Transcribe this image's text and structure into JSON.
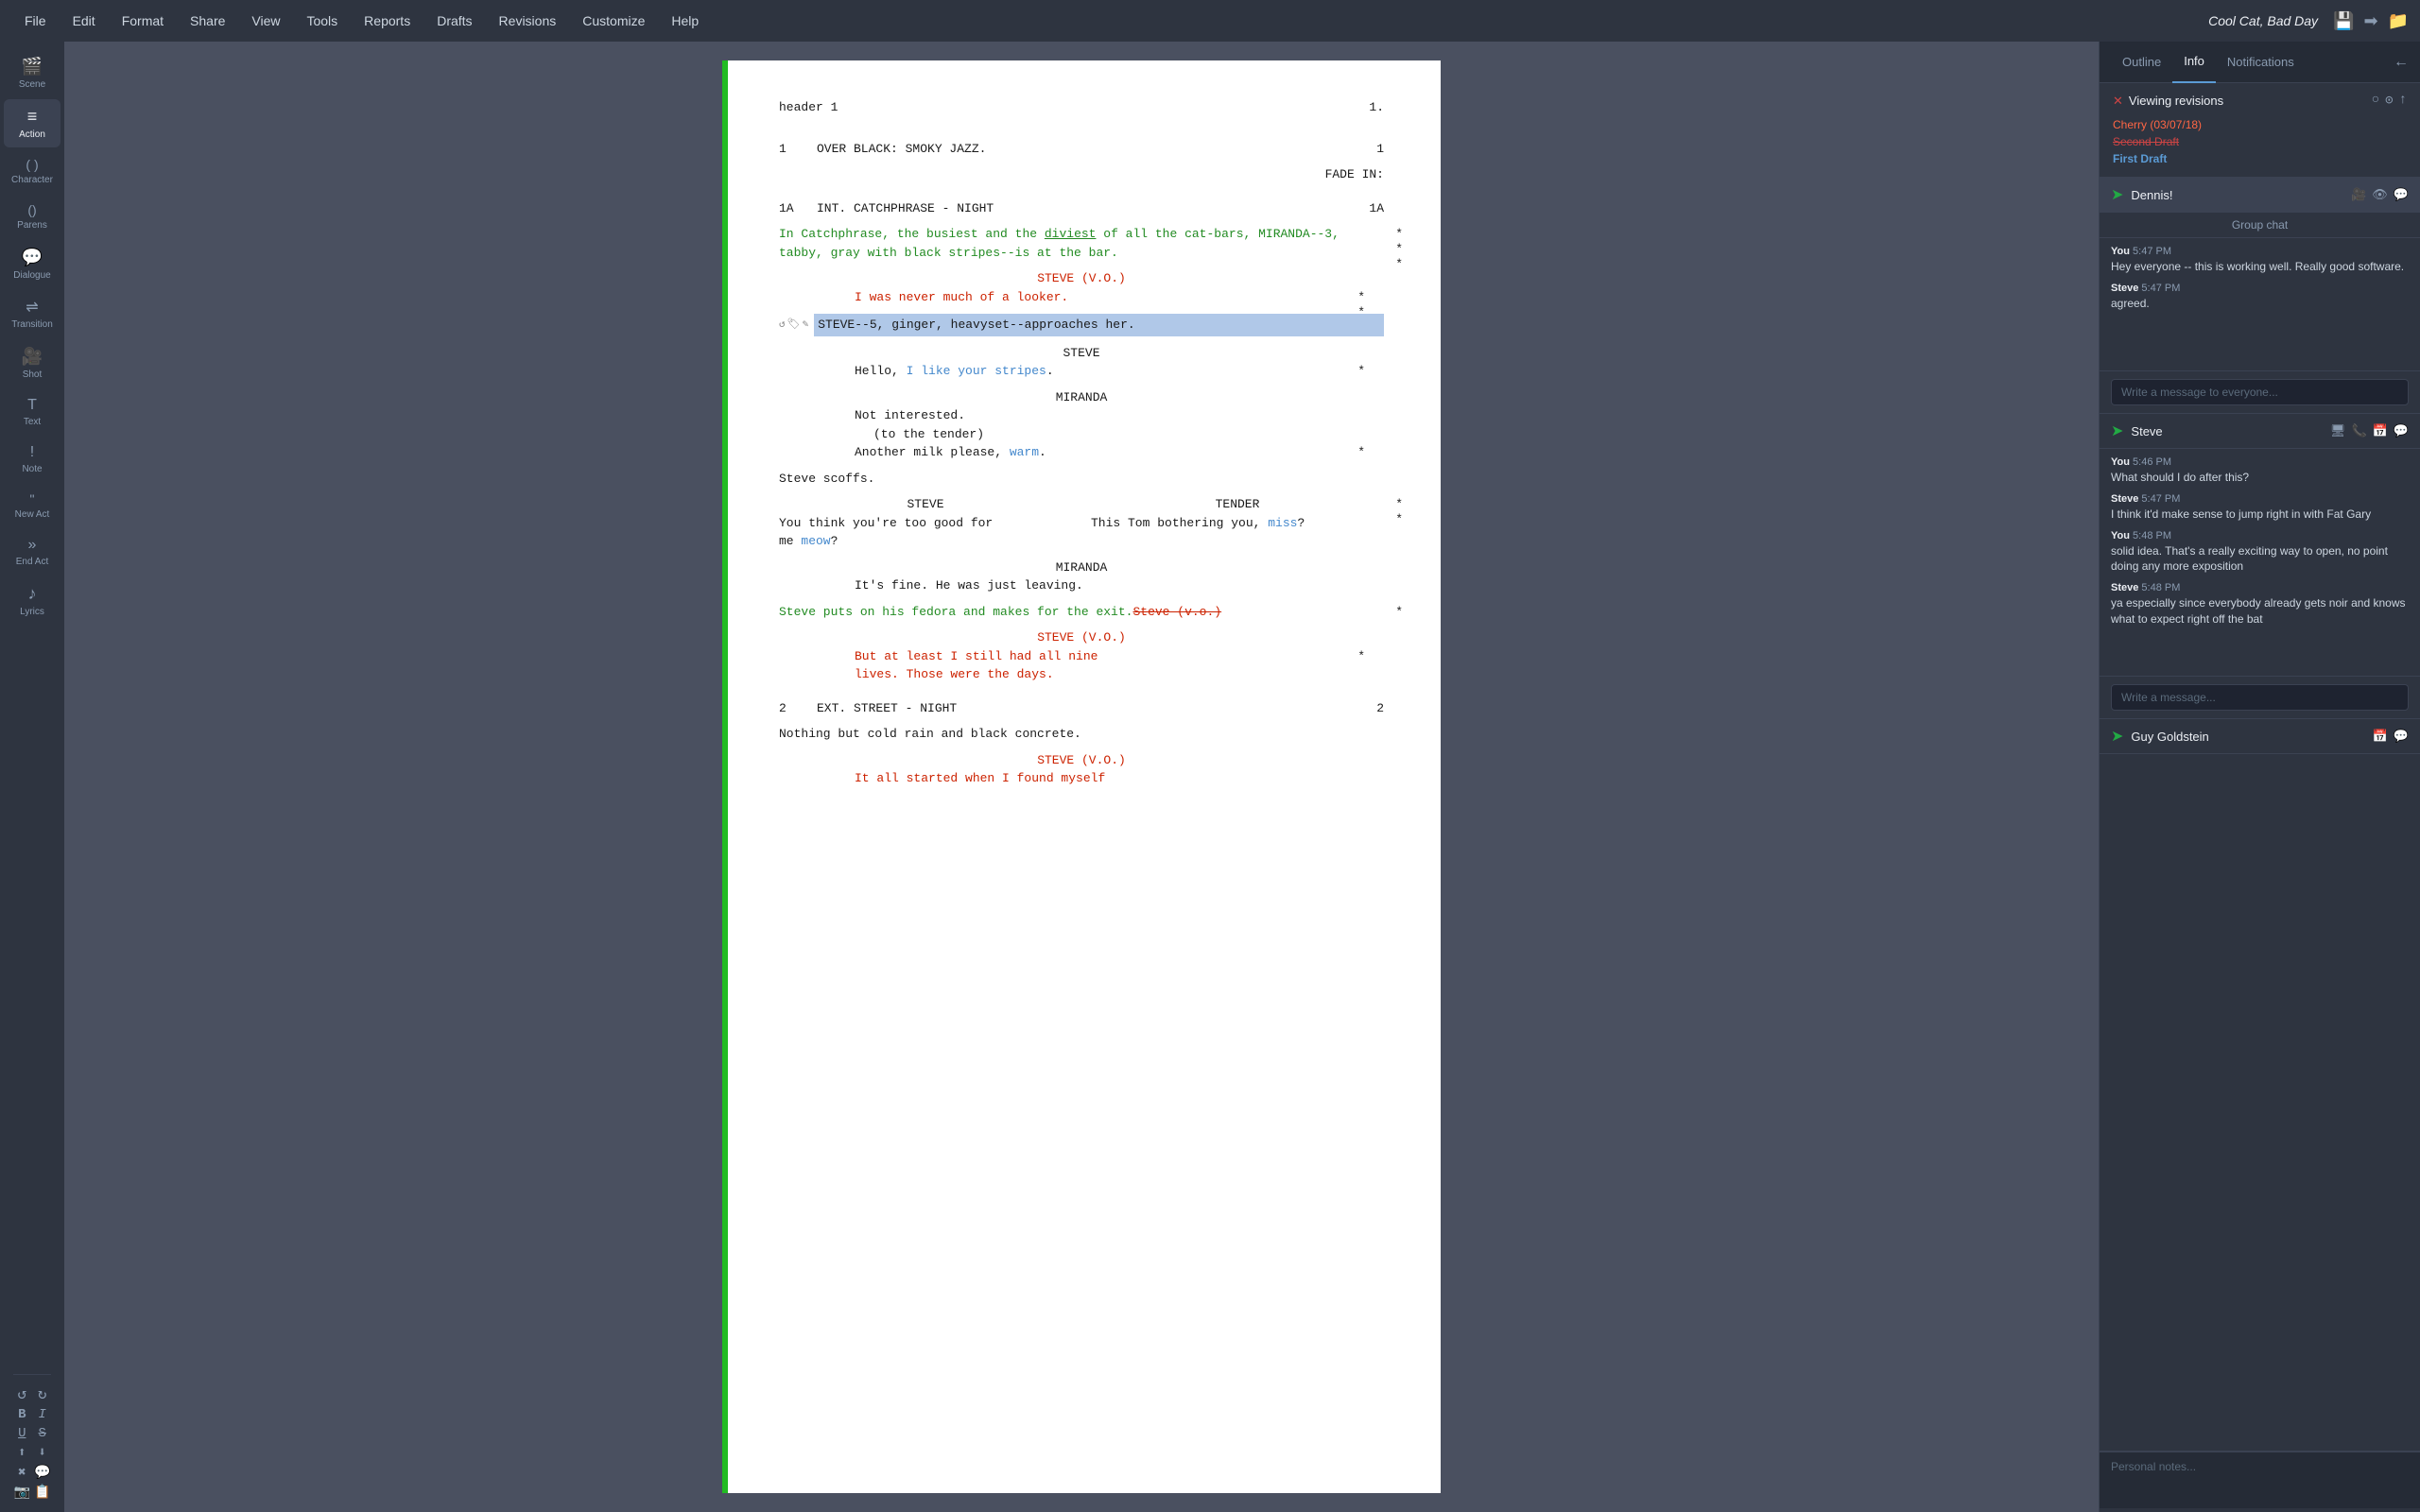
{
  "menubar": {
    "items": [
      "File",
      "Edit",
      "Format",
      "Share",
      "View",
      "Tools",
      "Reports",
      "Drafts",
      "Revisions",
      "Customize",
      "Help"
    ],
    "title": "Cool Cat, Bad Day"
  },
  "left_sidebar": {
    "buttons": [
      {
        "id": "scene",
        "icon": "🎬",
        "label": "Scene"
      },
      {
        "id": "action",
        "icon": "≡",
        "label": "Action"
      },
      {
        "id": "character",
        "icon": "( )",
        "label": "Character"
      },
      {
        "id": "parens",
        "icon": "()",
        "label": "Parens"
      },
      {
        "id": "dialogue",
        "icon": "💬",
        "label": "Dialogue"
      },
      {
        "id": "transition",
        "icon": "→",
        "label": "Transition"
      },
      {
        "id": "shot",
        "icon": "🎥",
        "label": "Shot"
      },
      {
        "id": "text",
        "icon": "T",
        "label": "Text"
      },
      {
        "id": "note",
        "icon": "!",
        "label": "Note"
      },
      {
        "id": "new-act",
        "icon": "\"",
        "label": "New Act"
      },
      {
        "id": "end-act",
        "icon": "»",
        "label": "End Act"
      },
      {
        "id": "lyrics",
        "icon": "♪",
        "label": "Lyrics"
      }
    ],
    "bottom_icons": [
      "↺",
      "↻",
      "B",
      "I",
      "U",
      "S",
      "⬆",
      "⬇",
      "✖",
      "💬",
      "📷",
      "📋"
    ]
  },
  "right_panel": {
    "tabs": [
      "Outline",
      "Info",
      "Notifications"
    ],
    "active_tab": "Info",
    "viewing_revisions": {
      "title": "Viewing revisions",
      "revisions": [
        {
          "label": "Cherry (03/07/18)",
          "style": "cherry"
        },
        {
          "label": "Second Draft",
          "style": "second"
        },
        {
          "label": "First Draft",
          "style": "first"
        }
      ]
    },
    "contacts": [
      {
        "name": "Dennis!",
        "icon": "➤",
        "active": true,
        "actions": [
          "🎥",
          "👁",
          "💬"
        ],
        "group_chat_label": "Group chat",
        "messages": [
          {
            "sender": "You",
            "time": "5:47 PM",
            "text": "Hey everyone -- this is working well. Really good software."
          },
          {
            "sender": "Steve",
            "time": "5:47 PM",
            "text": "agreed."
          }
        ],
        "input_placeholder": "Write a message to everyone..."
      },
      {
        "name": "Steve",
        "icon": "➤",
        "active": false,
        "actions": [
          "🖥",
          "📞",
          "📅",
          "💬"
        ],
        "messages": [
          {
            "sender": "You",
            "time": "5:46 PM",
            "text": "What should I do after this?"
          },
          {
            "sender": "Steve",
            "time": "5:47 PM",
            "text": "I think it'd make sense to jump right in with Fat Gary"
          },
          {
            "sender": "You",
            "time": "5:48 PM",
            "text": "solid idea. That's a really exciting way to open, no point doing any more exposition"
          },
          {
            "sender": "Steve",
            "time": "5:48 PM",
            "text": "ya especially since everybody already gets noir and knows what to expect right off the bat"
          }
        ],
        "input_placeholder": "Write a message..."
      },
      {
        "name": "Guy Goldstein",
        "icon": "➤",
        "active": false,
        "actions": [
          "📅",
          "💬"
        ],
        "messages": [],
        "input_placeholder": ""
      }
    ],
    "personal_notes_placeholder": "Personal notes..."
  },
  "script": {
    "header": "header 1",
    "page_number": "1.",
    "elements": [
      {
        "type": "action",
        "number": "1",
        "text": "OVER BLACK: SMOKY JAZZ.",
        "right_num": "1"
      },
      {
        "type": "transition",
        "text": "FADE IN:"
      },
      {
        "type": "scene_heading",
        "number": "1A",
        "text": "INT. CATCHPHRASE - NIGHT",
        "right_num": "1A"
      },
      {
        "type": "action_addition",
        "text": "In Catchphrase, the busiest and the diviest of all the cat-bars, MIRANDA--3, tabby, gray with black stripes--is at the bar.",
        "asterisks": [
          "*",
          "*",
          "*"
        ]
      },
      {
        "type": "vo_name",
        "text": "STEVE (V.O.)"
      },
      {
        "type": "vo_dialogue",
        "text": "I was never much of a looker.",
        "asterisks": [
          "*",
          "*"
        ]
      },
      {
        "type": "action_highlighted",
        "text": "STEVE--5, ginger, heavyset--approaches her."
      },
      {
        "type": "char_name",
        "text": "STEVE"
      },
      {
        "type": "dialogue_inline",
        "parts": [
          {
            "text": "Hello, ",
            "style": "normal"
          },
          {
            "text": "I like your stripes",
            "style": "blue"
          },
          {
            "text": ".",
            "style": "normal"
          }
        ],
        "asterisk": "*"
      },
      {
        "type": "char_name",
        "text": "MIRANDA"
      },
      {
        "type": "dialogue",
        "text": "Not interested."
      },
      {
        "type": "parenthetical",
        "text": "(to the tender)"
      },
      {
        "type": "dialogue_inline",
        "parts": [
          {
            "text": "Another milk please, ",
            "style": "normal"
          },
          {
            "text": "warm",
            "style": "blue"
          },
          {
            "text": ".",
            "style": "normal"
          }
        ],
        "asterisk": "*"
      },
      {
        "type": "action",
        "text": "Steve scoffs."
      },
      {
        "type": "dual_dialogue",
        "left": {
          "char": "STEVE",
          "text": "You think you're too good for\nme meow?"
        },
        "right": {
          "char": "TENDER",
          "text": "This Tom bothering you, miss?"
        },
        "asterisks": [
          "*",
          "*"
        ]
      },
      {
        "type": "char_name",
        "text": "MIRANDA"
      },
      {
        "type": "dialogue",
        "text": "It's fine. He was just leaving."
      },
      {
        "type": "action_addition",
        "text": "Steve puts on his fedora and makes for the exit.",
        "deletion": "Steve (v.o.)",
        "asterisk": "*"
      },
      {
        "type": "vo_name",
        "text": "STEVE (V.O.)"
      },
      {
        "type": "vo_dialogue_multi",
        "lines": [
          "But at least I still had all nine",
          "lives. Those were the days."
        ],
        "asterisk": "*"
      },
      {
        "type": "scene_heading",
        "number": "2",
        "text": "EXT. STREET - NIGHT",
        "right_num": "2"
      },
      {
        "type": "action",
        "text": "Nothing but cold rain and black concrete."
      },
      {
        "type": "vo_name2",
        "text": "STEVE (V.O.)"
      },
      {
        "type": "vo_dialogue_trunc",
        "text": "It all started when I found myself"
      }
    ]
  }
}
